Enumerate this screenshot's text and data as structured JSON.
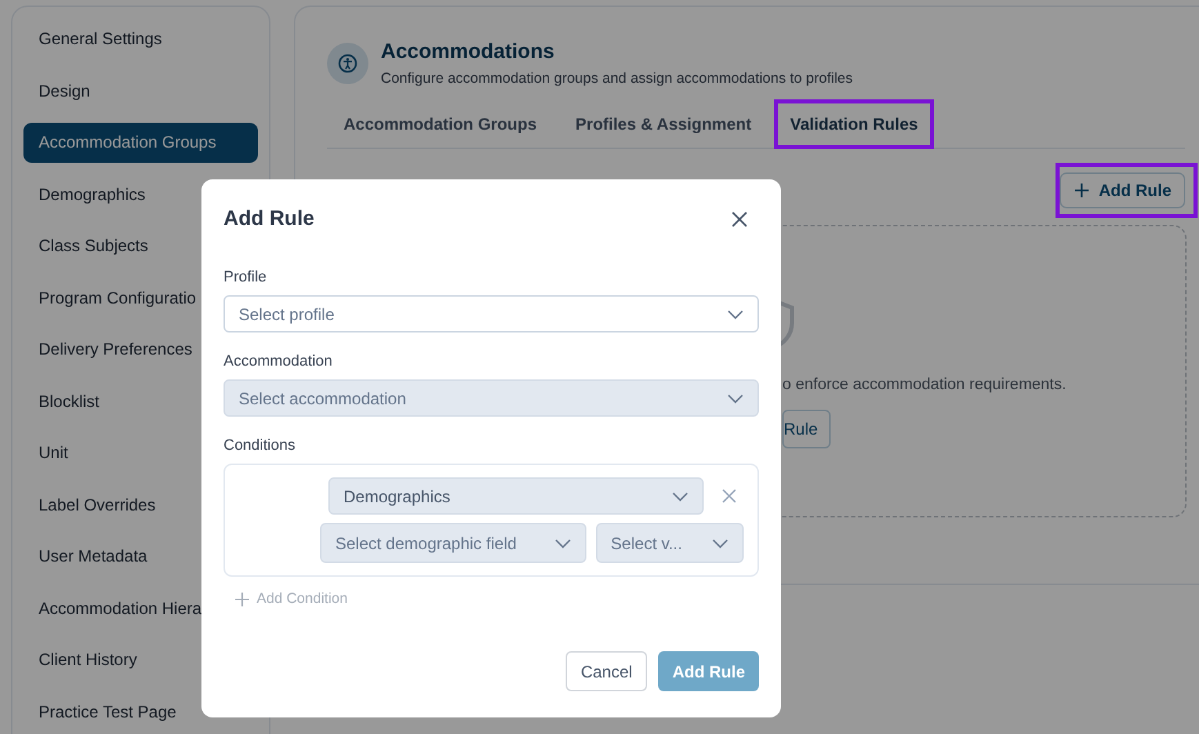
{
  "sidebar": {
    "items": [
      {
        "label": "General Settings",
        "selected": false
      },
      {
        "label": "Design",
        "selected": false
      },
      {
        "label": "Accommodation Groups",
        "selected": true
      },
      {
        "label": "Demographics",
        "selected": false
      },
      {
        "label": "Class Subjects",
        "selected": false
      },
      {
        "label": "Program Configuratio",
        "selected": false
      },
      {
        "label": "Delivery Preferences",
        "selected": false
      },
      {
        "label": "Blocklist",
        "selected": false
      },
      {
        "label": "Unit",
        "selected": false
      },
      {
        "label": "Label Overrides",
        "selected": false
      },
      {
        "label": "User Metadata",
        "selected": false
      },
      {
        "label": "Accommodation Hiera",
        "selected": false
      },
      {
        "label": "Client History",
        "selected": false
      },
      {
        "label": "Practice Test Page",
        "selected": false
      }
    ]
  },
  "header": {
    "title": "Accommodations",
    "subtitle": "Configure accommodation groups and assign accommodations to profiles"
  },
  "tabs": [
    {
      "label": "Accommodation Groups",
      "selected": false,
      "highlighted": false
    },
    {
      "label": "Profiles & Assignment",
      "selected": false,
      "highlighted": false
    },
    {
      "label": "Validation Rules",
      "selected": true,
      "highlighted": true
    }
  ],
  "add_button": {
    "label": "Add Rule",
    "highlighted": true
  },
  "empty_state": {
    "text": "o enforce accommodation requirements.",
    "button": "Rule"
  },
  "dialog": {
    "title": "Add Rule",
    "fields": [
      {
        "label": "Profile",
        "placeholder": "Select profile",
        "disabled": false
      },
      {
        "label": "Accommodation",
        "placeholder": "Select accommodation",
        "disabled": true
      }
    ],
    "conditions": {
      "label": "Conditions",
      "items": [
        {
          "category": "Demographics",
          "field_placeholder": "Select demographic field",
          "value_placeholder": "Select v..."
        }
      ]
    },
    "add_condition": {
      "label": "Add Condition",
      "disabled": true
    },
    "cancel": "Cancel",
    "submit": {
      "label": "Add Rule",
      "disabled": true
    }
  }
}
